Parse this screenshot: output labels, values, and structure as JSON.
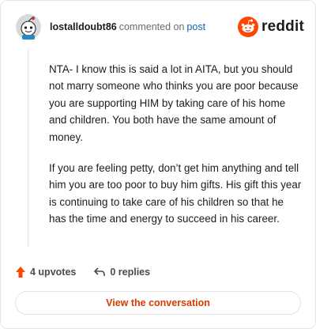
{
  "header": {
    "username": "lostalldoubt86",
    "action": "commented on",
    "post_link": "post",
    "brand": "reddit",
    "brand_color": "#ff4500"
  },
  "comment": {
    "paragraphs": [
      "NTA- I know this is said a lot in AITA, but you should not marry someone who thinks you are poor because you are supporting HIM by taking care of his home and children. You both have the same amount of money.",
      "If you are feeling petty, don’t get him anything and tell him you are too poor to buy him gifts. His gift this year is continuing to take care of his children so that he has the time and energy to succeed in his career."
    ]
  },
  "actions": {
    "upvotes": "4 upvotes",
    "replies": "0 replies",
    "upvote_icon": "upvote-arrow-icon",
    "reply_icon": "reply-icon"
  },
  "cta": {
    "label": "View the conversation",
    "color": "#d93a00"
  }
}
